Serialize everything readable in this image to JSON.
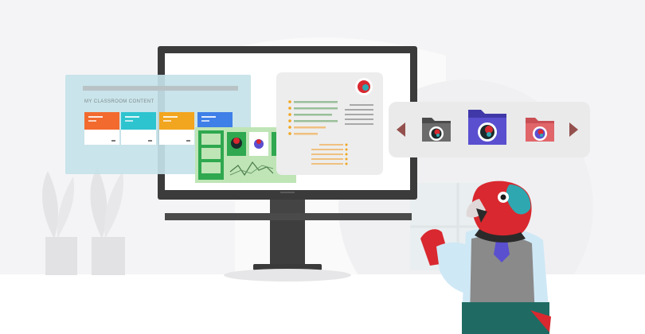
{
  "classroom_panel": {
    "title": "MY CLASSROOM CONTENT",
    "cards": [
      {
        "color": "#f26a2e"
      },
      {
        "color": "#2ec4cf"
      },
      {
        "color": "#f2a51e"
      },
      {
        "color": "#3f7fe8"
      }
    ]
  },
  "colors": {
    "monitor": "#3b3b3b",
    "screen": "#ffffff",
    "green_panel": "#bfe5b6",
    "green_dark": "#2fa84f",
    "folder_gray": "#6b6b6b",
    "folder_purple": "#5a4fcf",
    "folder_red": "#e0666a",
    "arrow": "#93504d",
    "bird_red": "#d9282f",
    "bird_teal": "#2fa7b0",
    "vest": "#8a8a8a",
    "shirt": "#cfe8f6"
  },
  "icons": {
    "left_arrow": "chevron-left-icon",
    "right_arrow": "chevron-right-icon",
    "folder": "folder-icon",
    "mascot": "bird-mascot-icon"
  }
}
